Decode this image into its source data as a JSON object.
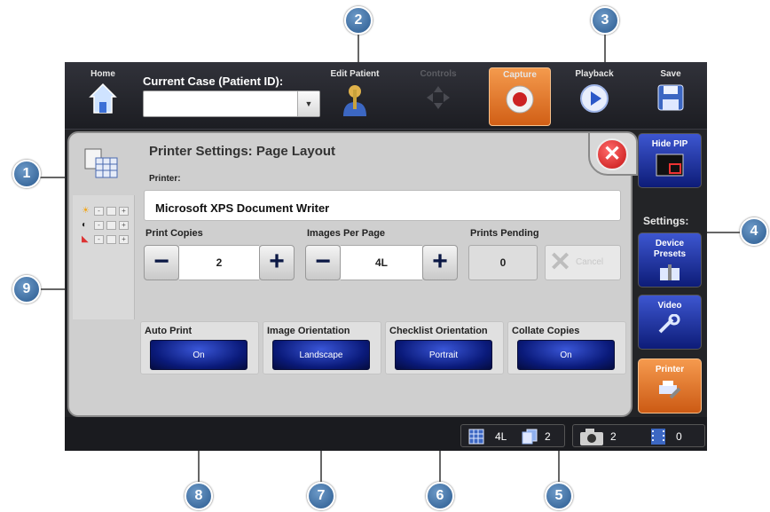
{
  "topbar": {
    "home_label": "Home",
    "case_label": "Current Case (Patient ID):",
    "case_value": "",
    "edit_patient_label": "Edit Patient",
    "controls_label": "Controls",
    "capture_label": "Capture",
    "playback_label": "Playback",
    "save_label": "Save"
  },
  "panel": {
    "title": "Printer Settings: Page Layout",
    "printer_label": "Printer:",
    "printer_value": "Microsoft XPS Document Writer",
    "print_copies_label": "Print Copies",
    "print_copies_value": "2",
    "images_per_page_label": "Images Per Page",
    "images_per_page_value": "4L",
    "prints_pending_label": "Prints Pending",
    "prints_pending_value": "0",
    "cancel_label": "Cancel",
    "minus_glyph": "−",
    "plus_glyph": "+",
    "close_glyph": "✕"
  },
  "toggles": [
    {
      "label": "Auto Print",
      "value": "On"
    },
    {
      "label": "Image Orientation",
      "value": "Landscape"
    },
    {
      "label": "Checklist Orientation",
      "value": "Portrait"
    },
    {
      "label": "Collate Copies",
      "value": "On"
    }
  ],
  "right_panel": {
    "hide_pip_label": "Hide PIP",
    "settings_label": "Settings:",
    "device_presets_label": "Device Presets",
    "video_label": "Video",
    "printer_label": "Printer"
  },
  "statusbar": {
    "layout_value": "4L",
    "copies_value": "2",
    "photos_count": "2",
    "videos_count": "0"
  },
  "callouts": [
    "1",
    "2",
    "3",
    "4",
    "5",
    "6",
    "7",
    "8",
    "9"
  ],
  "colors": {
    "accent_orange": "#e67a2c",
    "button_blue": "#0d1c78",
    "callout_blue": "#3b6ea5",
    "close_red": "#d62020"
  }
}
